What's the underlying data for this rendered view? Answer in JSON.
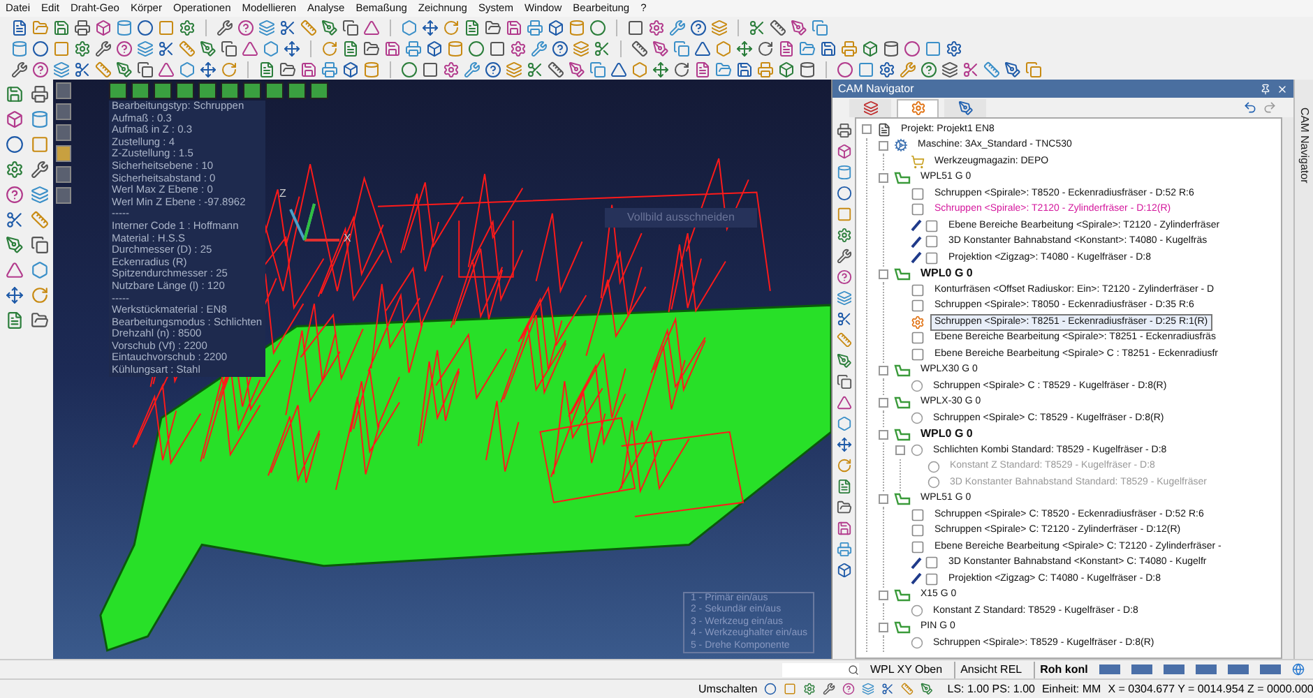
{
  "menu": [
    "Datei",
    "Edit",
    "Draht-Geo",
    "Körper",
    "Operationen",
    "Modellieren",
    "Analyse",
    "Bemaßung",
    "Zeichnung",
    "System",
    "Window",
    "Bearbeitung",
    "?"
  ],
  "info_lines": [
    "Bearbeitungstyp: Schruppen",
    "Aufmaß : 0.3",
    "Aufmaß in Z : 0.3",
    "Zustellung : 4",
    "Z-Zustellung : 1.5",
    "Sicherheitsebene : 10",
    "Sicherheitsabstand : 0",
    "Werl Max Z Ebene : 0",
    "Werl Min Z Ebene : -97.8962",
    "-----",
    "Interner Code 1 : Hoffmann",
    "Material : H.S.S",
    "Durchmesser (D) : 25",
    "Eckenradius (R)",
    "Spitzendurchmesser : 25",
    "Nutzbare Länge (l) : 120",
    "-----",
    "Werkstückmaterial : EN8",
    "Bearbeitungsmodus : Schlichten",
    "Drehzahl (n) : 8500",
    "Vorschub (Vf) : 2200",
    "Eintauchvorschub : 2200",
    "Kühlungsart : Stahl"
  ],
  "hint": "Vollbild ausschneiden",
  "axes": {
    "x": "X",
    "z": "Z"
  },
  "legend": [
    "1 - Primär ein/aus",
    "2 - Sekundär ein/aus",
    "3 - Werkzeug ein/aus",
    "4 - Werkzeughalter ein/aus",
    "5 - Drehe Komponente"
  ],
  "navigator": {
    "title": "CAM Navigator",
    "side_tab": "CAM Navigator",
    "tabs": [
      {
        "kind": "layers",
        "selected": false
      },
      {
        "kind": "gear",
        "selected": true
      },
      {
        "kind": "path",
        "selected": false
      }
    ],
    "tree": [
      {
        "label": "Projekt: Projekt1 EN8",
        "kind": "project",
        "selected": false,
        "highlighted": false,
        "disabled": false,
        "children": [
          {
            "label": "Maschine: 3Ax_Standard - TNC530",
            "kind": "machine",
            "selected": false,
            "highlighted": false,
            "disabled": false,
            "children": [
              {
                "label": "Werkzeugmagazin: DEPO",
                "kind": "magazine",
                "selected": false,
                "highlighted": false,
                "disabled": false
              }
            ]
          },
          {
            "label": "WPL51 G 0",
            "kind": "workplane",
            "active": false,
            "selected": false,
            "highlighted": false,
            "disabled": false,
            "children": [
              {
                "label": "Schruppen <Spirale>: T8520 - Eckenradiusfräser - D:52 R:6",
                "kind": "operation",
                "selected": false,
                "highlighted": false,
                "disabled": false
              },
              {
                "label": "Schruppen <Spirale>: T2120 - Zylinderfräser - D:12(R)",
                "kind": "operation",
                "selected": false,
                "highlighted": true,
                "disabled": false
              },
              {
                "label": "Ebene Bereiche Bearbeitung <Spirale>: T2120 - Zylinderfräser",
                "kind": "linked",
                "selected": false,
                "highlighted": false,
                "disabled": false
              },
              {
                "label": "3D Konstanter Bahnabstand <Konstant>: T4080 - Kugelfräs",
                "kind": "linked",
                "selected": false,
                "highlighted": false,
                "disabled": false
              },
              {
                "label": "Projektion <Zigzag>: T4080 - Kugelfräser - D:8",
                "kind": "linked",
                "selected": false,
                "highlighted": false,
                "disabled": false
              }
            ]
          },
          {
            "label": "WPL0 G 0",
            "kind": "workplane",
            "active": true,
            "selected": false,
            "highlighted": false,
            "disabled": false,
            "children": [
              {
                "label": "Konturfräsen <Offset Radiuskor: Ein>: T2120 - Zylinderfräser - D",
                "kind": "operation",
                "selected": false,
                "highlighted": false,
                "disabled": false
              },
              {
                "label": "Schruppen <Spirale>: T8050 - Eckenradiusfräser - D:35 R:6",
                "kind": "operation",
                "selected": false,
                "highlighted": false,
                "disabled": false
              },
              {
                "label": "Schruppen <Spirale>: T8251 - Eckenradiusfräser - D:25 R:1(R)",
                "kind": "operation",
                "selected": true,
                "highlighted": false,
                "disabled": false
              },
              {
                "label": "Ebene Bereiche Bearbeitung <Spirale>: T8251 - Eckenradiusfräs",
                "kind": "operation",
                "selected": false,
                "highlighted": false,
                "disabled": false
              },
              {
                "label": "Ebene Bereiche Bearbeitung <Spirale> C : T8251 - Eckenradiusfr",
                "kind": "operation",
                "selected": false,
                "highlighted": false,
                "disabled": false
              }
            ]
          },
          {
            "label": "WPLX30 G 0",
            "kind": "workplane",
            "active": false,
            "selected": false,
            "highlighted": false,
            "disabled": false,
            "children": [
              {
                "label": "Schruppen <Spirale> C : T8529 - Kugelfräser - D:8(R)",
                "kind": "ball",
                "selected": false,
                "highlighted": false,
                "disabled": false
              }
            ]
          },
          {
            "label": "WPLX-30 G 0",
            "kind": "workplane",
            "active": false,
            "selected": false,
            "highlighted": false,
            "disabled": false,
            "children": [
              {
                "label": "Schruppen <Spirale> C: T8529 - Kugelfräser - D:8(R)",
                "kind": "ball",
                "selected": false,
                "highlighted": false,
                "disabled": false
              }
            ]
          },
          {
            "label": "WPL0 G 0",
            "kind": "workplane",
            "active": true,
            "selected": false,
            "highlighted": false,
            "disabled": false,
            "children": [
              {
                "label": "Schlichten Kombi Standard: T8529 - Kugelfräser - D:8",
                "kind": "ball",
                "selected": false,
                "highlighted": false,
                "disabled": false,
                "children": [
                  {
                    "label": "Konstant Z Standard: T8529 - Kugelfräser - D:8",
                    "kind": "ball",
                    "selected": false,
                    "highlighted": false,
                    "disabled": true
                  },
                  {
                    "label": "3D Konstanter Bahnabstand Standard: T8529 - Kugelfräser",
                    "kind": "ball",
                    "selected": false,
                    "highlighted": false,
                    "disabled": true
                  }
                ]
              }
            ]
          },
          {
            "label": "WPL51 G 0",
            "kind": "workplane",
            "active": false,
            "selected": false,
            "highlighted": false,
            "disabled": false,
            "children": [
              {
                "label": "Schruppen <Spirale> C: T8520 - Eckenradiusfräser - D:52 R:6",
                "kind": "operation",
                "selected": false,
                "highlighted": false,
                "disabled": false
              },
              {
                "label": "Schruppen <Spirale> C: T2120 - Zylinderfräser - D:12(R)",
                "kind": "operation",
                "selected": false,
                "highlighted": false,
                "disabled": false
              },
              {
                "label": "Ebene Bereiche Bearbeitung <Spirale> C: T2120 - Zylinderfräser -",
                "kind": "operation",
                "selected": false,
                "highlighted": false,
                "disabled": false
              },
              {
                "label": "3D Konstanter Bahnabstand <Konstant> C: T4080 - Kugelfr",
                "kind": "linked",
                "selected": false,
                "highlighted": false,
                "disabled": false
              },
              {
                "label": "Projektion <Zigzag> C: T4080 - Kugelfräser - D:8",
                "kind": "linked",
                "selected": false,
                "highlighted": false,
                "disabled": false
              }
            ]
          },
          {
            "label": "X15 G 0",
            "kind": "workplane",
            "active": false,
            "selected": false,
            "highlighted": false,
            "disabled": false,
            "children": [
              {
                "label": "Konstant Z Standard: T8529 - Kugelfräser - D:8",
                "kind": "ball",
                "selected": false,
                "highlighted": false,
                "disabled": false
              }
            ]
          },
          {
            "label": "PIN G 0",
            "kind": "workplane",
            "active": false,
            "selected": false,
            "highlighted": false,
            "disabled": false,
            "children": [
              {
                "label": "Schruppen <Spirale>: T8529 - Kugelfräser - D:8(R)",
                "kind": "ball",
                "selected": false,
                "highlighted": false,
                "disabled": false
              }
            ]
          }
        ]
      }
    ]
  },
  "status": {
    "view": "WPL XY Oben",
    "mode": "Ansicht REL",
    "stock": "Roh konl",
    "toggle": "Umschalten",
    "scale": "LS: 1.00 PS: 1.00",
    "unit": "Einheit: MM",
    "coords": "X = 0304.677 Y = 0014.954 Z = 0000.000"
  }
}
